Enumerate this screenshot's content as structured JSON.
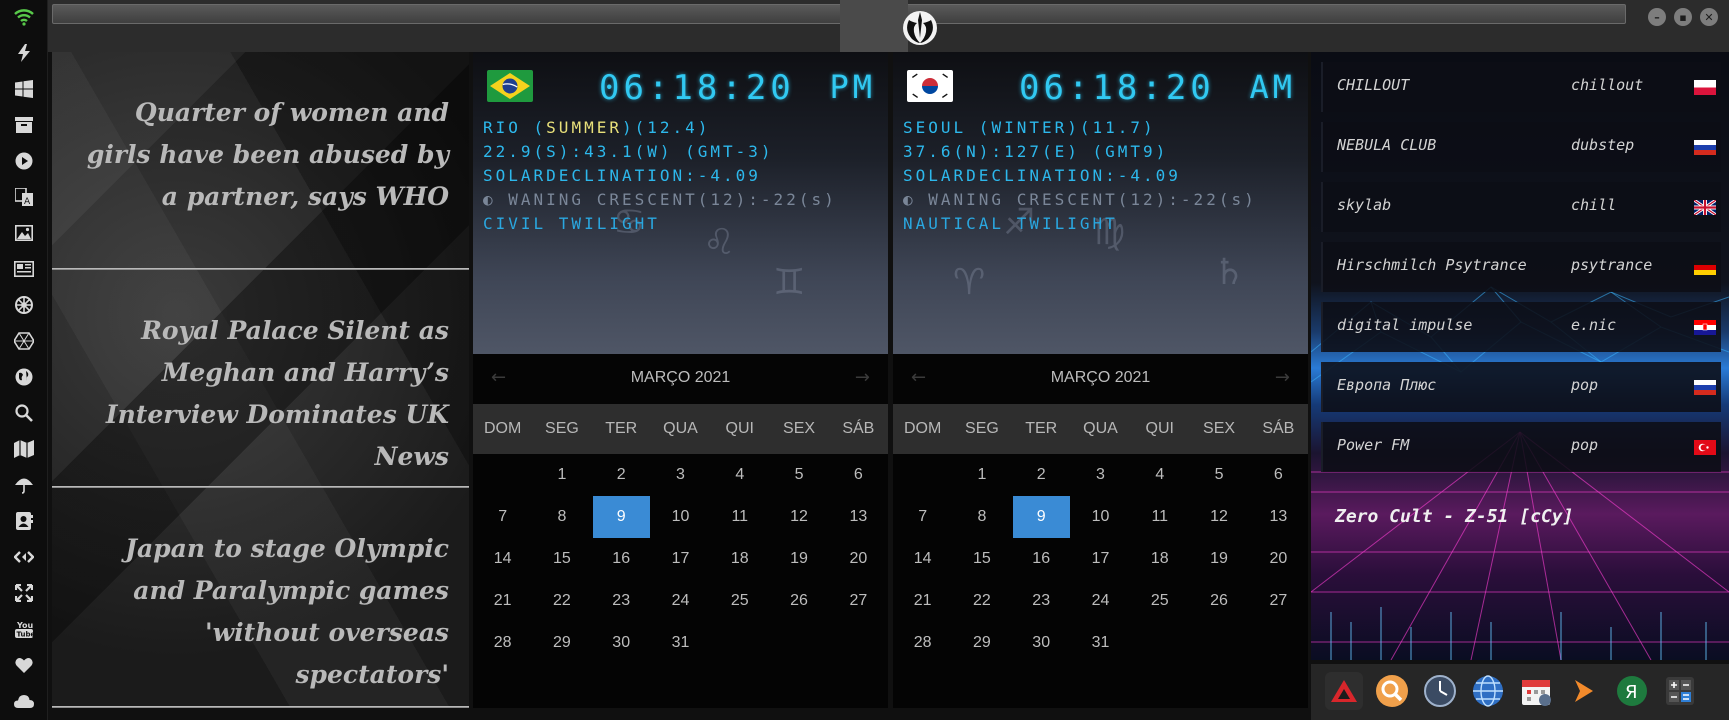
{
  "sidebar": {
    "icons": [
      "wifi-icon",
      "bolt-icon",
      "windows-icon",
      "archive-icon",
      "play-icon",
      "translate-icon",
      "image-icon",
      "news-icon",
      "empire-icon",
      "atom-icon",
      "globe-icon",
      "search-icon",
      "map-icon",
      "umbrella-icon",
      "contacts-icon",
      "code-icon",
      "fullscreen-icon",
      "youtube-icon",
      "heart-icon",
      "cloud-icon"
    ]
  },
  "titlebar": {
    "emblem": "rebel-alliance-icon",
    "buttons": [
      "minimize",
      "maximize",
      "close"
    ]
  },
  "news": {
    "headlines": [
      "Quarter of women and girls have been abused by a partner, says WHO",
      "Royal Palace Silent as Meghan and Harry’s Interview Dominates UK News",
      "Japan to stage Olympic and Paralympic games 'without overseas spectators'"
    ]
  },
  "clocks": [
    {
      "country": "Brazil",
      "time": "06:18:20",
      "ampm": "PM",
      "city": "RIO",
      "season": "SUMMER",
      "season_extra": "(12.4)",
      "coords": "22.9(S):43.1(W) (GMT-3)",
      "solar": "SOLARDECLINATION:-4.09",
      "moon": "WANING CRESCENT(12):-22",
      "moon_unit": "(s)",
      "twilight": "CIVIL TWILIGHT"
    },
    {
      "country": "South Korea",
      "time": "06:18:20",
      "ampm": "AM",
      "city": "SEOUL",
      "season": "WINTER",
      "season_extra": "(11.7)",
      "coords": "37.6(N):127(E) (GMT9)",
      "solar": "SOLARDECLINATION:-4.09",
      "moon": "WANING CRESCENT(12):-22",
      "moon_unit": "(s)",
      "twilight": "NAUTICAL TWILIGHT"
    }
  ],
  "calendar": {
    "month_label": "MARÇO 2021",
    "weekdays": [
      "DOM",
      "SEG",
      "TER",
      "QUA",
      "QUI",
      "SEX",
      "SÁB"
    ],
    "first_weekday": 1,
    "days_in_month": 31,
    "today": 9,
    "today_color": "#3a8bd5"
  },
  "radio": {
    "stations": [
      {
        "name": "CHILLOUT",
        "genre": "chillout",
        "flag": "pl"
      },
      {
        "name": "NEBULA CLUB",
        "genre": "dubstep",
        "flag": "ru"
      },
      {
        "name": "skylab",
        "genre": "chill",
        "flag": "gb"
      },
      {
        "name": "Hirschmilch Psytrance",
        "genre": "psytrance",
        "flag": "de"
      },
      {
        "name": "digital impulse",
        "genre": "e.nic",
        "flag": "hr"
      },
      {
        "name": "Европа Плюс",
        "genre": "pop",
        "flag": "ru"
      },
      {
        "name": "Power FM",
        "genre": "pop",
        "flag": "tr"
      }
    ],
    "now_playing": "Zero Cult - Z-51 [cCy]"
  },
  "dock": {
    "apps": [
      "arcade-icon",
      "search-app-icon",
      "clock-app-icon",
      "globe-app-icon",
      "calendar-app-icon",
      "media-arrow-icon",
      "yandex-icon",
      "calculator-icon"
    ]
  },
  "colors": {
    "accent": "#31c9f2",
    "season_highlight": "#e8e07a",
    "wifi": "#58c94a"
  }
}
